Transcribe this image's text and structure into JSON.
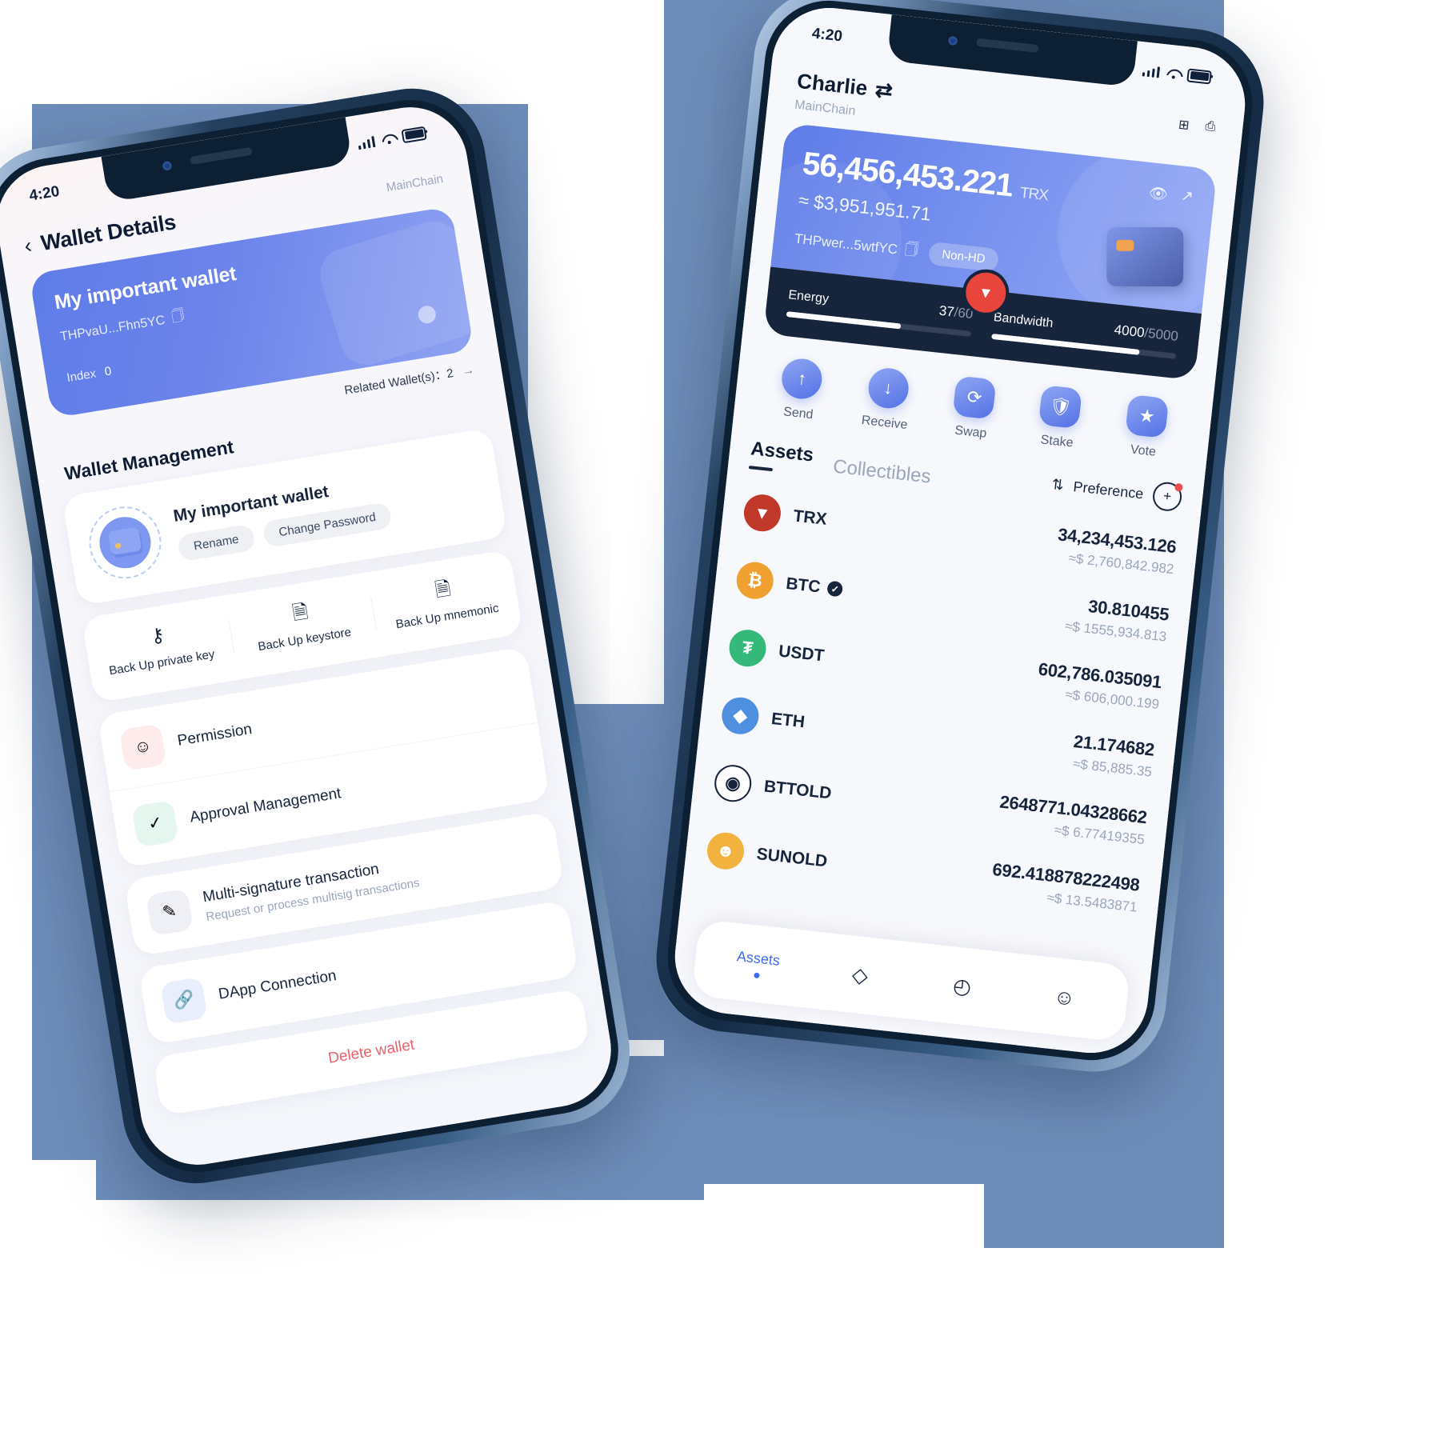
{
  "left_phone": {
    "status": {
      "time": "4:20"
    },
    "nav": {
      "back_icon": "chevron-left-icon",
      "title": "Wallet Details",
      "chain": "MainChain"
    },
    "wallet_card": {
      "name": "My important wallet",
      "address": "THPvaU...Fhn5YC",
      "copy_icon": "copy-icon",
      "index_label": "Index",
      "index_value": "0"
    },
    "related": {
      "label": "Related Wallet(s)：2",
      "arrow": "→"
    },
    "section_title": "Wallet Management",
    "wallet_row": {
      "name": "My important wallet",
      "rename_label": "Rename",
      "change_password_label": "Change Password"
    },
    "backup": [
      {
        "icon": "key-icon",
        "glyph": "⚷",
        "label": "Back Up\nprivate key"
      },
      {
        "icon": "keystore-icon",
        "glyph": "🗎",
        "label": "Back Up\nkeystore"
      },
      {
        "icon": "mnemonic-icon",
        "glyph": "🗎",
        "label": "Back Up\nmnemonic"
      }
    ],
    "list": [
      {
        "icon": "permission-user-icon",
        "title": "Permission",
        "sub": ""
      },
      {
        "icon": "approval-user-check-icon",
        "title": "Approval Management",
        "sub": ""
      },
      {
        "icon": "pencil-icon",
        "title": "Multi-signature transaction",
        "sub": "Request or process multisig transactions"
      },
      {
        "icon": "link-icon",
        "title": "DApp Connection",
        "sub": ""
      }
    ],
    "delete_label": "Delete wallet"
  },
  "right_phone": {
    "status": {
      "time": "4:20"
    },
    "header": {
      "account": "Charlie",
      "switch_icon": "swap-arrows-icon",
      "chain": "MainChain",
      "add_icon": "add-wallet-icon",
      "scan_icon": "scan-icon"
    },
    "balance": {
      "amount": "56,456,453.221",
      "unit": "TRX",
      "usd": "≈ $3,951,951.71",
      "address": "THPwer...5wtfYC",
      "copy_icon": "copy-icon",
      "badge": "Non-HD",
      "eye_icon": "eye-icon",
      "share_icon": "arrow-up-right-icon"
    },
    "resources": [
      {
        "label": "Energy",
        "used": "37",
        "total": "60",
        "percent": 62
      },
      {
        "label": "Bandwidth",
        "used": "4000",
        "total": "5000",
        "percent": 80
      }
    ],
    "actions": [
      {
        "icon": "arrow-up-icon",
        "glyph": "↑",
        "label": "Send"
      },
      {
        "icon": "arrow-down-icon",
        "glyph": "↓",
        "label": "Receive"
      },
      {
        "icon": "swap-icon",
        "glyph": "⟳",
        "label": "Swap"
      },
      {
        "icon": "shield-icon",
        "glyph": "⛨",
        "label": "Stake"
      },
      {
        "icon": "ticket-icon",
        "glyph": "★",
        "label": "Vote"
      }
    ],
    "tabs": [
      {
        "label": "Assets",
        "active": true
      },
      {
        "label": "Collectibles",
        "active": false
      }
    ],
    "preference": {
      "sort_icon": "sort-icon",
      "label": "Preference",
      "add_token_icon": "add-token-icon"
    },
    "assets": [
      {
        "symbol": "TRX",
        "color": "#c0392b",
        "glyph": "◬",
        "verified": false,
        "amount": "34,234,453.126",
        "usd": "≈$ 2,760,842.982"
      },
      {
        "symbol": "BTC",
        "color": "#f0a030",
        "glyph": "₿",
        "verified": true,
        "amount": "30.810455",
        "usd": "≈$ 1555,934.813"
      },
      {
        "symbol": "USDT",
        "color": "#34b97a",
        "glyph": "₮",
        "verified": false,
        "amount": "602,786.035091",
        "usd": "≈$ 606,000.199"
      },
      {
        "symbol": "ETH",
        "color": "#4f8fe0",
        "glyph": "◆",
        "verified": false,
        "amount": "21.174682",
        "usd": "≈$ 85,885.35"
      },
      {
        "symbol": "BTTOLD",
        "color": "#ffffff",
        "glyph": "◎",
        "verified": false,
        "amount": "2648771.04328662",
        "usd": "≈$ 6.77419355"
      },
      {
        "symbol": "SUNOLD",
        "color": "#f2b23e",
        "glyph": "☻",
        "verified": false,
        "amount": "692.418878222498",
        "usd": "≈$ 13.5483871"
      }
    ],
    "navbar": [
      {
        "label": "Assets",
        "icon": "assets-icon",
        "active": true
      },
      {
        "label": "",
        "icon": "layers-icon",
        "glyph": "◇",
        "active": false
      },
      {
        "label": "",
        "icon": "explore-icon",
        "glyph": "◔",
        "active": false
      },
      {
        "label": "",
        "icon": "profile-icon",
        "glyph": "☺",
        "active": false
      }
    ]
  },
  "colors": {
    "accent": "#5f7ce8",
    "dark": "#16243c",
    "danger": "#ef5f6a",
    "muted": "#9aa6bb"
  }
}
